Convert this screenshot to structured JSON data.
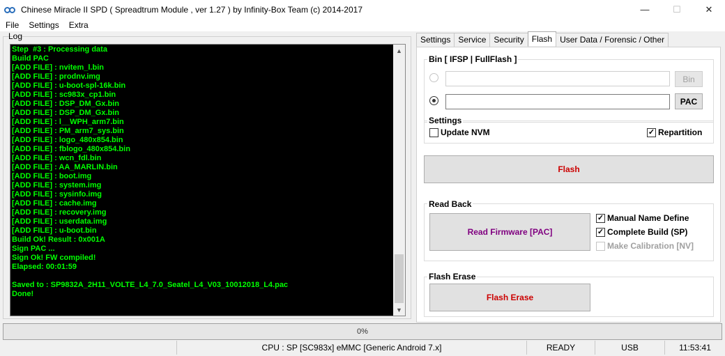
{
  "window": {
    "title": "Chinese Miracle II SPD ( Spreadtrum Module , ver 1.27 ) by Infinity-Box Team (c) 2014-2017",
    "minimize": "—",
    "maximize": "☐",
    "close": "✕"
  },
  "menu": [
    "File",
    "Settings",
    "Extra"
  ],
  "log": {
    "label": "Log",
    "lines": [
      "Step  #3 : Processing data",
      "Build PAC",
      "[ADD FILE] : nvitem_l.bin",
      "[ADD FILE] : prodnv.img",
      "[ADD FILE] : u-boot-spl-16k.bin",
      "[ADD FILE] : sc983x_cp1.bin",
      "[ADD FILE] : DSP_DM_Gx.bin",
      "[ADD FILE] : DSP_DM_Gx.bin",
      "[ADD FILE] : l__WPH_arm7.bin",
      "[ADD FILE] : PM_arm7_sys.bin",
      "[ADD FILE] : logo_480x854.bin",
      "[ADD FILE] : fblogo_480x854.bin",
      "[ADD FILE] : wcn_fdl.bin",
      "[ADD FILE] : AA_MARLIN.bin",
      "[ADD FILE] : boot.img",
      "[ADD FILE] : system.img",
      "[ADD FILE] : sysinfo.img",
      "[ADD FILE] : cache.img",
      "[ADD FILE] : recovery.img",
      "[ADD FILE] : userdata.img",
      "[ADD FILE] : u-boot.bin",
      "Build Ok! Result : 0x001A",
      "Sign PAC ...",
      "Sign Ok! FW compiled!",
      "Elapsed: 00:01:59",
      "",
      "Saved to : SP9832A_2H11_VOLTE_L4_7.0_Seatel_L4_V03_10012018_L4.pac",
      "Done!"
    ]
  },
  "tabs": [
    "Settings",
    "Service",
    "Security",
    "Flash",
    "User Data / Forensic / Other"
  ],
  "active_tab": "Flash",
  "flash": {
    "bin_legend": "Bin  [ IFSP | FullFlash ]",
    "bin_button": "Bin",
    "pac_button": "PAC",
    "settings_legend": "Settings",
    "update_nvm": "Update NVM",
    "repartition": "Repartition",
    "flash_button": "Flash",
    "flash_button_color": "#cc0000",
    "readback_legend": "Read Back",
    "read_firmware_button": "Read Firmware [PAC]",
    "read_firmware_color": "#800080",
    "manual_name": "Manual Name Define",
    "complete_build": "Complete Build (SP)",
    "make_calibration": "Make Calibration [NV]",
    "erase_legend": "Flash Erase",
    "erase_button": "Flash Erase"
  },
  "progress": {
    "percent": 0,
    "label": "0%"
  },
  "status": {
    "cpu": "CPU : SP [SC983x] eMMC [Generic Android 7.x]",
    "state": "READY",
    "conn": "USB",
    "time": "11:53:41"
  }
}
